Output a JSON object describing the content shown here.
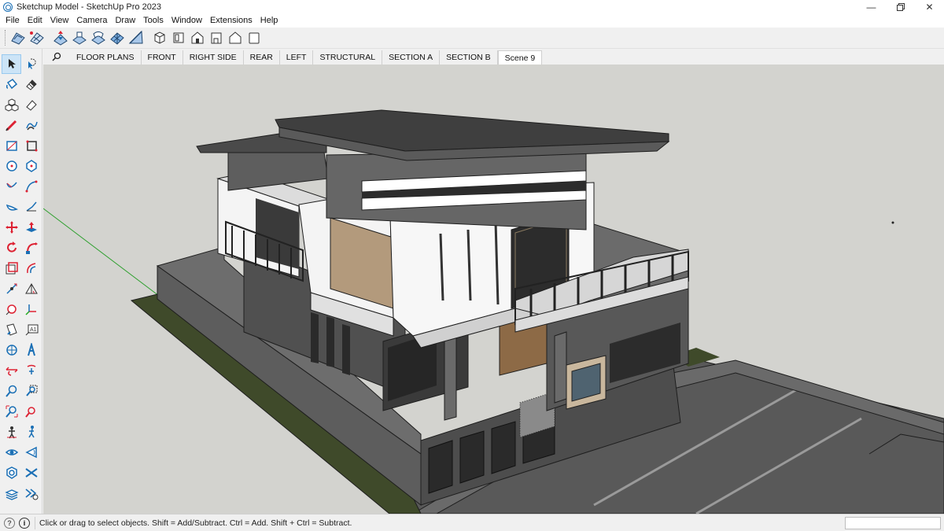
{
  "window": {
    "title": "Sketchup Model - SketchUp Pro 2023",
    "icon": "sketchup-logo-icon",
    "controls": [
      "minimize-icon",
      "restore-icon",
      "close-icon"
    ]
  },
  "menu": [
    "File",
    "Edit",
    "View",
    "Camera",
    "Draw",
    "Tools",
    "Window",
    "Extensions",
    "Help"
  ],
  "toolbar": {
    "icons": [
      "sandbox-from-contours-icon",
      "sandbox-from-scratch-icon",
      "smoove-icon",
      "stamp-icon",
      "drape-icon",
      "add-detail-icon",
      "flip-edge-icon",
      "iso-view-icon",
      "top-view-icon",
      "front-view-icon",
      "right-view-icon",
      "back-view-icon",
      "left-view-icon"
    ]
  },
  "scenes": {
    "search_icon": "magnifier-icon",
    "tabs": [
      "FLOOR PLANS",
      "FRONT",
      "RIGHT SIDE",
      "REAR",
      "LEFT",
      "STRUCTURAL",
      "SECTION A",
      "SECTION B",
      "Scene 9"
    ],
    "active": "Scene 9"
  },
  "tools": [
    "select-icon",
    "lasso-icon",
    "paint-bucket-icon",
    "eraser-icon",
    "component-icon",
    "tag-eraser-icon",
    "line-icon",
    "freehand-icon",
    "rectangle-icon",
    "rotated-rectangle-icon",
    "circle-icon",
    "polygon-icon",
    "arc-icon",
    "two-point-arc-icon",
    "pie-icon",
    "three-point-arc-icon",
    "move-icon",
    "push-pull-icon",
    "rotate-icon",
    "follow-me-icon",
    "scale-icon",
    "offset-icon",
    "tape-measure-icon",
    "protractor-icon",
    "dimension-icon",
    "axes-icon",
    "text-icon",
    "3d-text-icon",
    "section-plane-icon",
    "orbit-icon",
    "pan-icon",
    "zoom-icon",
    "zoom-window-icon",
    "zoom-extents-icon",
    "previous-view-icon",
    "position-camera-icon",
    "walk-icon",
    "look-around-icon",
    "section-display-icon",
    "3d-warehouse-icon",
    "extension-warehouse-icon",
    "layout-icon",
    "extension-manager-icon"
  ],
  "status": {
    "help_icon": "question-icon",
    "info_icon": "info-icon",
    "message": "Click or drag to select objects. Shift = Add/Subtract. Ctrl = Add. Shift + Ctrl = Subtract."
  },
  "colors": {
    "viewport_bg": "#d3d3cf",
    "roof": "#4a4a4a",
    "wall_dark": "#5c5c5c",
    "wall_white": "#f4f4f4",
    "wood": "#b39a7c",
    "grass": "#3f4a2a",
    "road": "#555555",
    "axis_green": "#2fa02f"
  }
}
